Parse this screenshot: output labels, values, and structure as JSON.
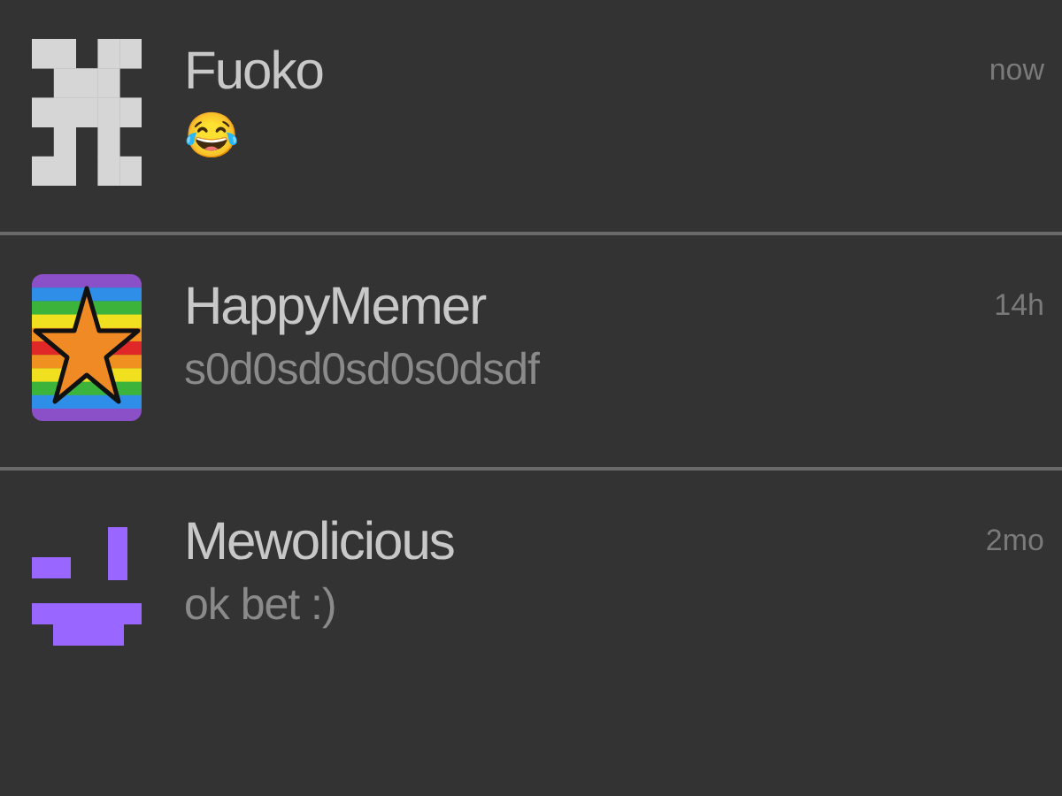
{
  "conversations": [
    {
      "name": "Fuoko",
      "message": "😂",
      "time": "now",
      "avatar": {
        "kind": "blocks"
      }
    },
    {
      "name": "HappyMemer",
      "message": "s0d0sd0sd0s0dsdf",
      "time": "14h",
      "avatar": {
        "kind": "star"
      }
    },
    {
      "name": "Mewolicious",
      "message": "ok bet :)",
      "time": "2mo",
      "avatar": {
        "kind": "face"
      }
    }
  ]
}
